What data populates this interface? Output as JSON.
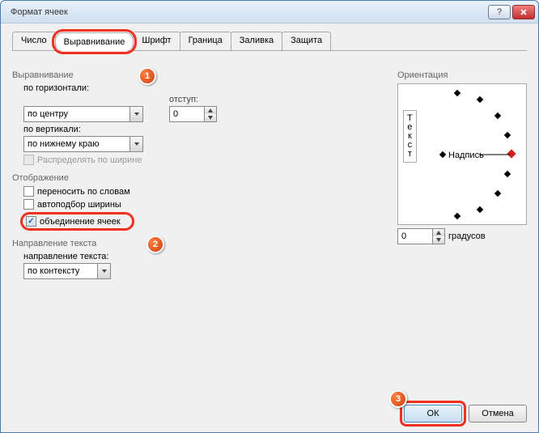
{
  "title": "Формат ячеек",
  "tabs": [
    {
      "label": "Число"
    },
    {
      "label": "Выравнивание"
    },
    {
      "label": "Шрифт"
    },
    {
      "label": "Граница"
    },
    {
      "label": "Заливка"
    },
    {
      "label": "Защита"
    }
  ],
  "alignment": {
    "section_label": "Выравнивание",
    "horizontal_label": "по горизонтали:",
    "horizontal_value": "по центру",
    "indent_label": "отступ:",
    "indent_value": "0",
    "vertical_label": "по вертикали:",
    "vertical_value": "по нижнему краю",
    "distribute_label": "Распределять по ширине"
  },
  "display": {
    "section_label": "Отображение",
    "wrap_label": "переносить по словам",
    "shrink_label": "автоподбор ширины",
    "merge_label": "объединение ячеек"
  },
  "text_direction": {
    "section_label": "Направление текста",
    "direction_label": "направление текста:",
    "direction_value": "по контексту"
  },
  "orientation": {
    "section_label": "Ориентация",
    "text_vertical": [
      "Т",
      "е",
      "к",
      "с",
      "т"
    ],
    "caption": "Надпись",
    "degrees_value": "0",
    "degrees_label": "градусов"
  },
  "buttons": {
    "ok": "ОК",
    "cancel": "Отмена"
  },
  "callouts": {
    "c1": "1",
    "c2": "2",
    "c3": "3"
  }
}
